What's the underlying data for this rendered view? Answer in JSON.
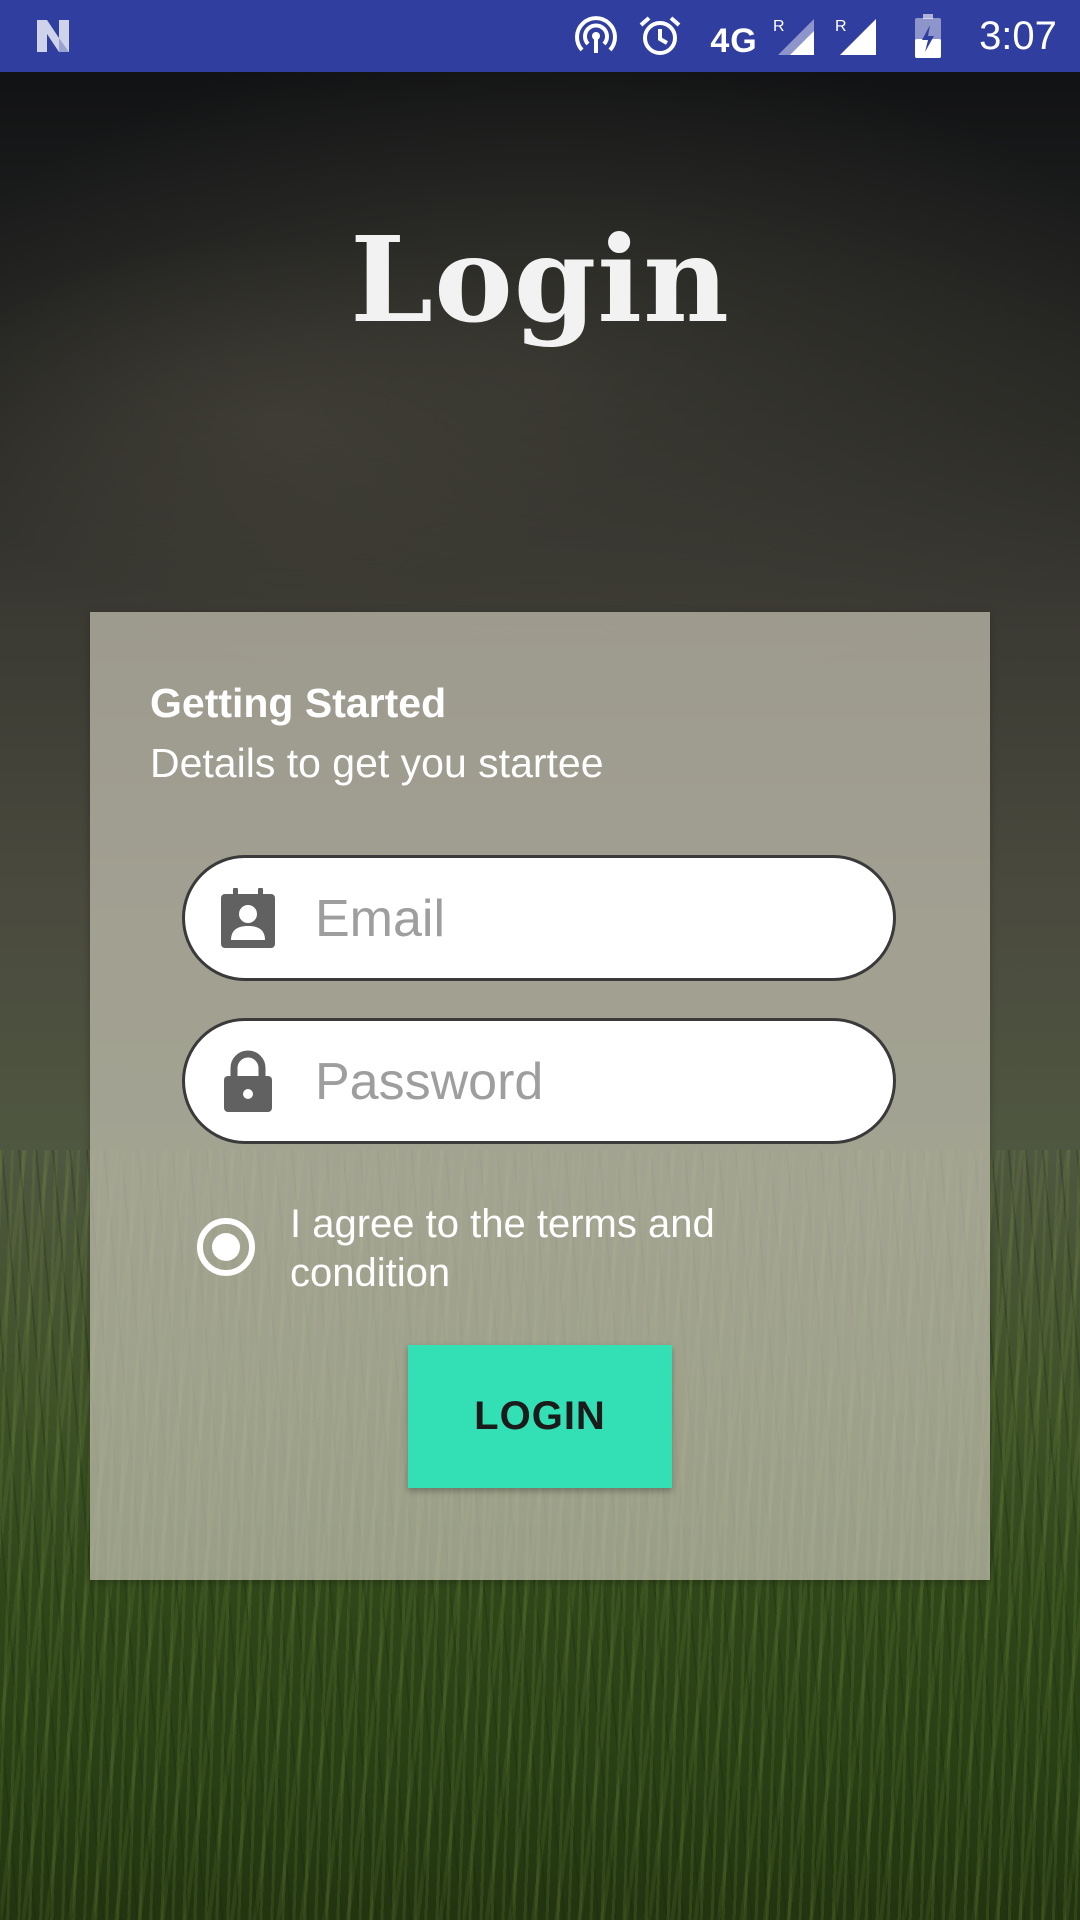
{
  "status_bar": {
    "network": "4G",
    "time": "3:07",
    "icons": [
      "n-logo-icon",
      "hotspot-icon",
      "alarm-icon",
      "signal-roaming-icon",
      "signal-roaming-icon",
      "battery-charging-icon"
    ],
    "background_color": "#303f9f"
  },
  "page": {
    "title": "Login"
  },
  "card": {
    "heading": "Getting Started",
    "subheading": "Details to get you startee"
  },
  "form": {
    "email": {
      "placeholder": "Email",
      "value": "",
      "icon": "contact-card-icon"
    },
    "password": {
      "placeholder": "Password",
      "value": "",
      "icon": "lock-icon"
    },
    "terms": {
      "label": "I agree to the terms and condition",
      "checked": true
    },
    "login_button": {
      "label": "LOGIN",
      "color": "#33e0b5"
    }
  }
}
